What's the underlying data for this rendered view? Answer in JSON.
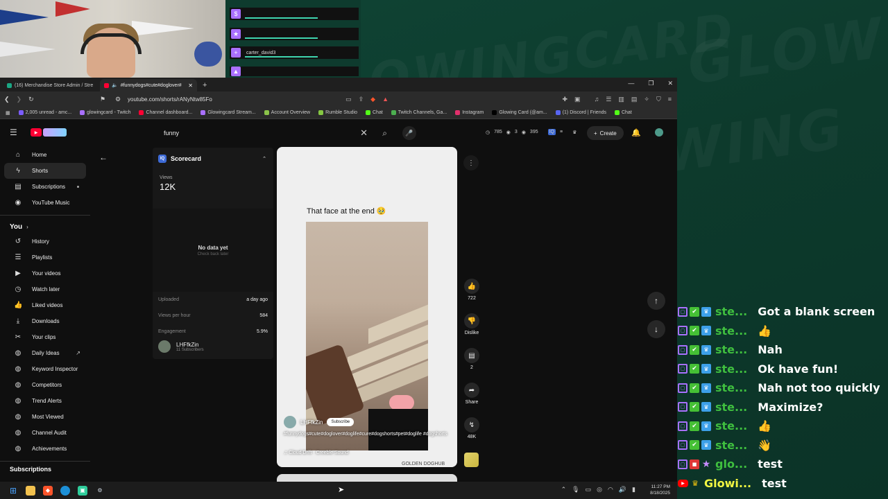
{
  "stream": {
    "bg_words": [
      "OWINGCARD",
      "GLOWING",
      "GLOWIN"
    ],
    "alerts": [
      {
        "name": ""
      },
      {
        "name": ""
      },
      {
        "name": "carter_david3"
      },
      {
        "name": ""
      }
    ]
  },
  "browser": {
    "tabs": [
      {
        "label": "(16) Merchandise Store Admin / Stre"
      },
      {
        "label": "#funnydogs#cute#doglover#"
      }
    ],
    "url": "youtube.com/shorts/rANyNtw85Fo",
    "bookmarks": [
      {
        "label": "2,005 unread - amc...",
        "color": "#7b5cff"
      },
      {
        "label": "glowingcard - Twitch",
        "color": "#a970ff"
      },
      {
        "label": "Channel dashboard...",
        "color": "#ff0033"
      },
      {
        "label": "Glowingcard Stream...",
        "color": "#a970ff"
      },
      {
        "label": "Account Overview",
        "color": "#8bc34a"
      },
      {
        "label": "Rumble Studio",
        "color": "#85c742"
      },
      {
        "label": "Chat",
        "color": "#53fc18"
      },
      {
        "label": "Twitch Channels, Ga...",
        "color": "#4caf50"
      },
      {
        "label": "Instagram",
        "color": "#e1306c"
      },
      {
        "label": "Glowing Card (@am...",
        "color": "#000000"
      },
      {
        "label": "(1) Discord | Friends",
        "color": "#5865f2"
      },
      {
        "label": "Chat",
        "color": "#53fc18"
      }
    ]
  },
  "youtube": {
    "search_value": "funny",
    "stats": {
      "a": "785",
      "b": "3",
      "c": "395"
    },
    "create_label": "Create",
    "sidebar": {
      "main": [
        {
          "label": "Home",
          "icon": "home-icon",
          "glyph": "⌂"
        },
        {
          "label": "Shorts",
          "icon": "shorts-icon",
          "glyph": "ϟ"
        },
        {
          "label": "Subscriptions",
          "icon": "subscriptions-icon",
          "glyph": "▤"
        },
        {
          "label": "YouTube Music",
          "icon": "youtube-music-icon",
          "glyph": "◉"
        }
      ],
      "you_label": "You",
      "you": [
        {
          "label": "History",
          "icon": "history-icon",
          "glyph": "↺"
        },
        {
          "label": "Playlists",
          "icon": "playlists-icon",
          "glyph": "☰"
        },
        {
          "label": "Your videos",
          "icon": "your-videos-icon",
          "glyph": "▶"
        },
        {
          "label": "Watch later",
          "icon": "watch-later-icon",
          "glyph": "◷"
        },
        {
          "label": "Liked videos",
          "icon": "liked-videos-icon",
          "glyph": "👍"
        },
        {
          "label": "Downloads",
          "icon": "downloads-icon",
          "glyph": "⤓"
        },
        {
          "label": "Your clips",
          "icon": "clips-icon",
          "glyph": "✂"
        },
        {
          "label": "Daily Ideas",
          "icon": "vidiq-icon",
          "glyph": "◍"
        },
        {
          "label": "Keyword Inspector",
          "icon": "vidiq-icon",
          "glyph": "◍"
        },
        {
          "label": "Competitors",
          "icon": "vidiq-icon",
          "glyph": "◍"
        },
        {
          "label": "Trend Alerts",
          "icon": "vidiq-icon",
          "glyph": "◍"
        },
        {
          "label": "Most Viewed",
          "icon": "vidiq-icon",
          "glyph": "◍"
        },
        {
          "label": "Channel Audit",
          "icon": "vidiq-icon",
          "glyph": "◍"
        },
        {
          "label": "Achievements",
          "icon": "vidiq-icon",
          "glyph": "◍"
        }
      ],
      "subscriptions_label": "Subscriptions"
    },
    "scorecard": {
      "title": "Scorecard",
      "views_label": "Views",
      "views_value": "12K",
      "no_data": "No data yet",
      "check_back": "Check back later",
      "rows": [
        {
          "label": "Uploaded",
          "value": "a day ago"
        },
        {
          "label": "Views per hour",
          "value": "584"
        },
        {
          "label": "Engagement",
          "value": "5.9%"
        }
      ],
      "channel_name": "LHFfkZin",
      "channel_subs": "11 Subscribers"
    },
    "video": {
      "caption": "That face at the end 🥹",
      "channel": "LHFfkZin",
      "subscribe_label": "Subscribe",
      "tags": "#funnydogs#cute#doglover#doglife#cure#dogshorts#pet#doglife #dogshorts",
      "sound": "♫ Cloud Drift · Creeble Sound",
      "watermark": "GOLDEN DOGHUB"
    },
    "actions": {
      "likes": "722",
      "dislike_label": "Dislike",
      "comments": "2",
      "share_label": "Share",
      "remix": "48K"
    }
  },
  "taskbar": {
    "time": "11:27 PM",
    "date": "8/18/2025"
  },
  "chat": [
    {
      "platform": "twitch",
      "user": "ste...",
      "user_color": "#3fbf3f",
      "msg": "Got a blank screen"
    },
    {
      "platform": "twitch",
      "user": "ste...",
      "user_color": "#3fbf3f",
      "msg": "👍"
    },
    {
      "platform": "twitch",
      "user": "ste...",
      "user_color": "#3fbf3f",
      "msg": "Nah"
    },
    {
      "platform": "twitch",
      "user": "ste...",
      "user_color": "#3fbf3f",
      "msg": "Ok have fun!"
    },
    {
      "platform": "twitch",
      "user": "ste...",
      "user_color": "#3fbf3f",
      "msg": "Nah not too quickly"
    },
    {
      "platform": "twitch",
      "user": "ste...",
      "user_color": "#3fbf3f",
      "msg": "Maximize?"
    },
    {
      "platform": "twitch",
      "user": "ste...",
      "user_color": "#3fbf3f",
      "msg": "👍"
    },
    {
      "platform": "twitch",
      "user": "ste...",
      "user_color": "#3fbf3f",
      "msg": "👋"
    },
    {
      "platform": "twitch-vip",
      "user": "glo...",
      "user_color": "#3fbf3f",
      "msg": "test"
    },
    {
      "platform": "youtube",
      "user": "Glowi...",
      "user_color": "#f1f542",
      "msg": "test"
    }
  ]
}
